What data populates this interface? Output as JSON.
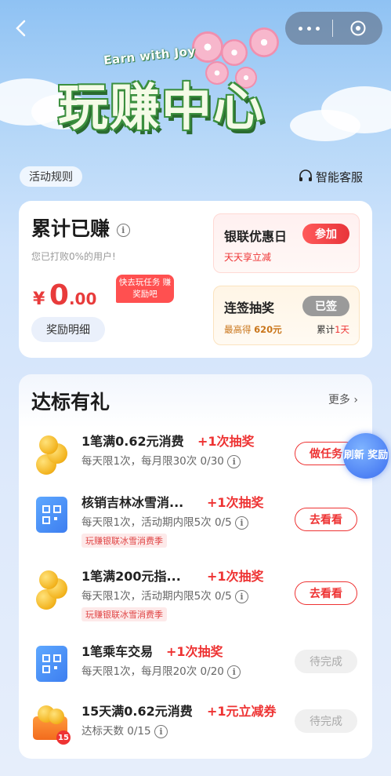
{
  "topbar": {
    "back_icon": "chevron-left-icon",
    "more_icon": "more-dots-icon",
    "close_icon": "close-circle-icon"
  },
  "hero": {
    "subtitle": "Earn with Joy",
    "title": "玩赚中心"
  },
  "rules_label": "活动规则",
  "service_label": "智能客服",
  "earnings": {
    "title": "累计已赚",
    "subtitle": "您已打败0%的用户!",
    "currency": "¥",
    "amount_int": "0",
    "amount_dec": ".00",
    "tip": "快去玩任务 赚奖励吧",
    "detail_label": "奖励明细"
  },
  "promo_discount": {
    "title": "银联优惠日",
    "subtitle": "天天享立减",
    "button": "参加"
  },
  "promo_lottery": {
    "title": "连签抽奖",
    "button": "已签",
    "max_prefix": "最高得",
    "max_value": "620元",
    "count_prefix": "累计",
    "count_value": "1天"
  },
  "tasks_section": {
    "title": "达标有礼",
    "more_label": "更多 ›",
    "refresh_label": "刷新 奖励"
  },
  "tasks": [
    {
      "name": "1笔满0.62元消费",
      "reward": "+1次抽奖",
      "desc": "每天限1次，每月限30次 0/30",
      "tag": "",
      "button": "做任务"
    },
    {
      "name": "核销吉林冰雪消...",
      "reward": "+1次抽奖",
      "desc": "每天限1次，活动期内限5次 0/5",
      "tag": "玩赚银联冰雪消费季",
      "button": "去看看"
    },
    {
      "name": "1笔满200元指...",
      "reward": "+1次抽奖",
      "desc": "每天限1次，活动期内限5次 0/5",
      "tag": "玩赚银联冰雪消费季",
      "button": "去看看"
    },
    {
      "name": "1笔乘车交易",
      "reward": "+1次抽奖",
      "desc": "每天限1次，每月限20次 0/20",
      "tag": "",
      "button": "待完成"
    },
    {
      "name": "15天满0.62元消费",
      "reward": "+1元立减券",
      "desc": "达标天数 0/15",
      "tag": "",
      "button": "待完成",
      "badge": "15"
    }
  ],
  "colors": {
    "accent_red": "#e83b3b",
    "card_bg": "#ffffff",
    "bg_blue": "#cfe3fb"
  }
}
